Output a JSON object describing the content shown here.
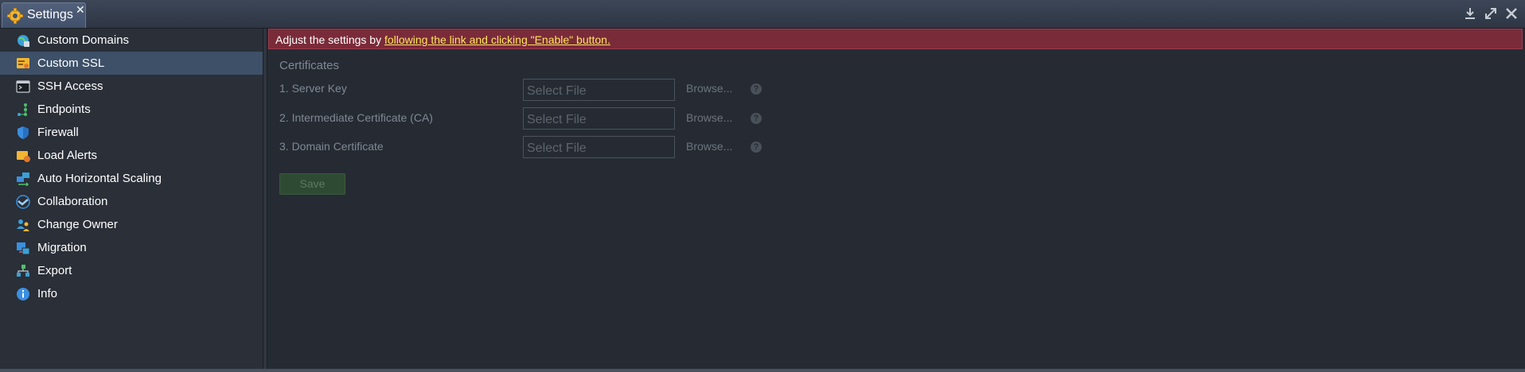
{
  "window": {
    "tab_title": "Settings",
    "close_glyph": "✕",
    "tools": [
      "download-icon",
      "expand-icon",
      "close-icon"
    ]
  },
  "sidebar": {
    "items": [
      {
        "label": "Custom Domains",
        "icon": "globe-icon"
      },
      {
        "label": "Custom SSL",
        "icon": "ssl-certificate-icon",
        "active": true
      },
      {
        "label": "SSH Access",
        "icon": "terminal-icon"
      },
      {
        "label": "Endpoints",
        "icon": "endpoints-icon"
      },
      {
        "label": "Firewall",
        "icon": "shield-icon"
      },
      {
        "label": "Load Alerts",
        "icon": "alert-icon"
      },
      {
        "label": "Auto Horizontal Scaling",
        "icon": "scaling-icon"
      },
      {
        "label": "Collaboration",
        "icon": "handshake-icon"
      },
      {
        "label": "Change Owner",
        "icon": "users-icon"
      },
      {
        "label": "Migration",
        "icon": "migration-icon"
      },
      {
        "label": "Export",
        "icon": "export-icon"
      },
      {
        "label": "Info",
        "icon": "info-icon"
      }
    ]
  },
  "alert": {
    "text": "Adjust the settings by ",
    "link": "following the link and clicking \"Enable\" button."
  },
  "certificates": {
    "title": "Certificates",
    "fields": [
      {
        "label": "1. Server Key",
        "placeholder": "Select File",
        "browse": "Browse...",
        "help": "?"
      },
      {
        "label": "2. Intermediate Certificate (CA)",
        "placeholder": "Select File",
        "browse": "Browse...",
        "help": "?"
      },
      {
        "label": "3. Domain Certificate",
        "placeholder": "Select File",
        "browse": "Browse...",
        "help": "?"
      }
    ],
    "save_label": "Save"
  },
  "colors": {
    "accent_active": "#3d5068",
    "alert_bg": "#7a2b39",
    "link": "#ffe55e"
  }
}
